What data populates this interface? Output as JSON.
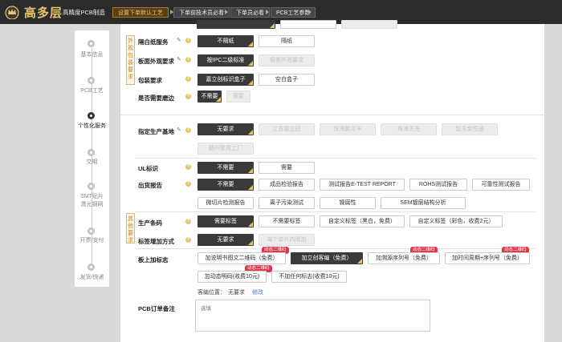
{
  "header": {
    "brand": "高多层",
    "brand_sub": "高精度PCB制造",
    "breadcrumbs": [
      "设置下单默认工艺",
      "下单前技术员必看",
      "下单员必看",
      "PCB工艺参数"
    ]
  },
  "sidebar": {
    "steps": [
      {
        "label": "基本信息"
      },
      {
        "label": "PCB工艺"
      },
      {
        "label": "个性化服务"
      },
      {
        "label": "交期"
      },
      {
        "label": "SMT贴片",
        "label2": "激光钢网"
      },
      {
        "label": "开票/支付"
      },
      {
        "label": "发货/快递"
      }
    ]
  },
  "groups": {
    "packing": "外观包装要求",
    "other": "其他要求"
  },
  "rows": {
    "top_partial": {
      "opts": [
        "",
        "",
        ""
      ]
    },
    "separator": {
      "label": "隔白纸服务",
      "opts": [
        "不隔纸",
        "隔纸"
      ]
    },
    "appearance": {
      "label": "板面外观要求",
      "opts": [
        "按IPC二级标准",
        "极美外观要求"
      ]
    },
    "packaging": {
      "label": "包装要求",
      "opts": [
        "嘉立创标识盒子",
        "空白盒子"
      ]
    },
    "edging": {
      "label": "是否需要磨边",
      "opts": [
        "不需要",
        "需要"
      ]
    },
    "production_base": {
      "label": "指定生产基地",
      "opts": [
        "无要求",
        "江苏嘉立创",
        "珠海鹏兆丰",
        "珠海先进",
        "韶关金悦通",
        "赣州聚真工厂"
      ]
    },
    "ul_mark": {
      "label": "UL标识",
      "opts": [
        "不需要",
        "需要"
      ]
    },
    "shipping_report": {
      "label": "出货报告",
      "opts": [
        "不需要",
        "成品检验报告",
        "测试报告E-TEST REPORT",
        "ROHS测试报告",
        "可靠性测试报告",
        "微切片检测报告",
        "离子污染测试",
        "镍腐性",
        "SEM镀层结构分析"
      ]
    },
    "barcode": {
      "label": "生产条码",
      "opts": [
        "需要标签",
        "不需要标签",
        "自定义标签（黑白，免费）",
        "自定义标签（彩色，收费2元）"
      ]
    },
    "label_method": {
      "label": "标签增加方式",
      "opts": [
        "无要求",
        "每个单片内增加"
      ]
    },
    "board_marking": {
      "label": "板上加标志",
      "opts": [
        "加说明书图文二维码（免费）",
        "加立创客编（免费）",
        "加溯源序列号（免费）",
        "加时间周期+序列号（免费）",
        "加动态明码(收费10元)",
        "不加任何标志(收费10元)"
      ],
      "badge": "动态二维码"
    },
    "customer_info": {
      "label": "客编位置：",
      "value": "无要求",
      "link": "修改"
    },
    "order_note": {
      "label": "PCB订单备注",
      "placeholder": "选填"
    }
  },
  "icons": {
    "hint": "?",
    "edit": "✎"
  },
  "colors": {
    "accent": "#e8c46a",
    "dark_selected": "#3a3a3a",
    "badge": "#e0364b",
    "topbar": "#2b2b2b"
  }
}
